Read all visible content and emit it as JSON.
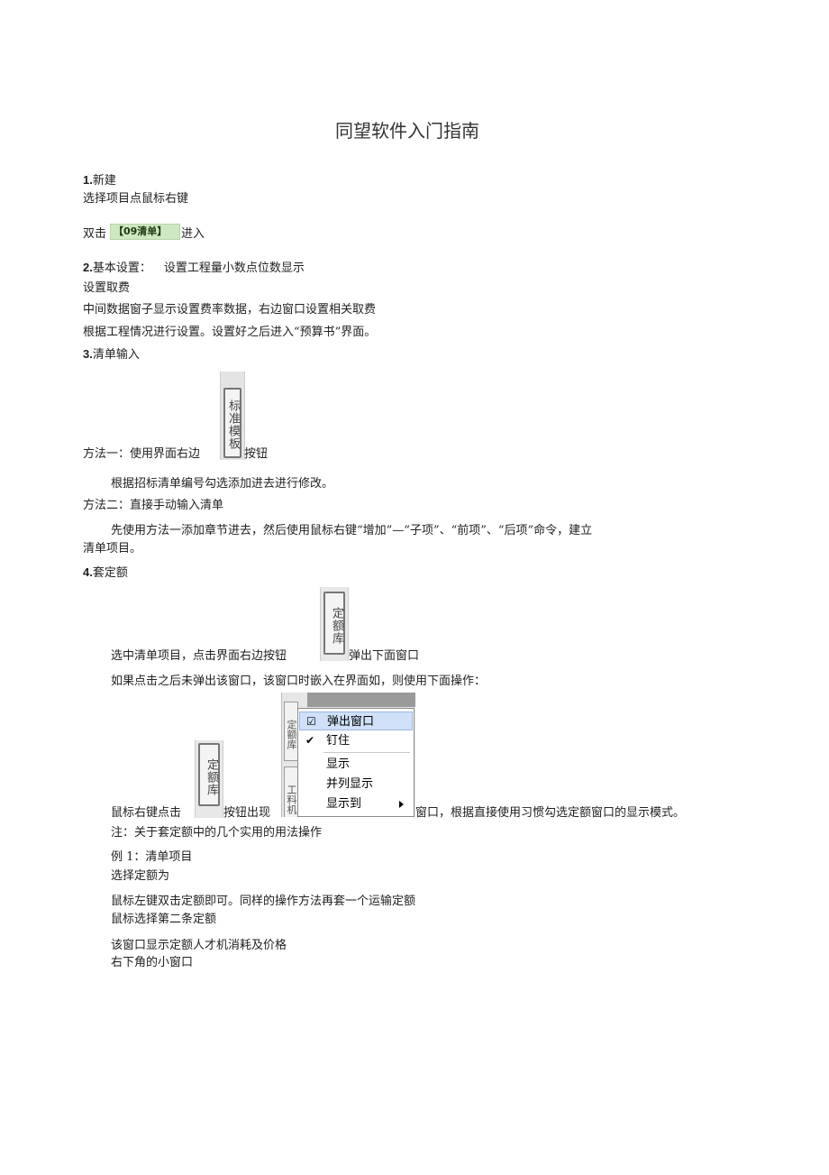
{
  "title": "同望软件入门指南",
  "sec1": {
    "num": "1.",
    "heading": "新建",
    "line1": "选择项目点鼠标右键",
    "line2_pre": "双击",
    "qd_button": "【09清单】",
    "line2_post": "进入"
  },
  "sec2": {
    "num": "2.",
    "heading": "基本设置：",
    "heading_tail": "设置工程量小数点位数显示",
    "line1": "设置取费",
    "line2": "中间数据窗子显示设置费率数据，右边窗口设置相关取费",
    "line3": "根据工程情况进行设置。设置好之后进入“预算书”界面。"
  },
  "sec3": {
    "num": "3.",
    "heading": "清单输入",
    "method1_pre": "方法一：使用界面右边",
    "template_button": "标准模板",
    "method1_post": "按钮",
    "method1_desc": "根据招标清单编号勾选添加进去进行修改。",
    "method2": "方法二：直接手动输入清单",
    "method2_desc_line1": "先使用方法一添加章节进去，然后使用鼠标右键“增加”—“子项”、“前项”、“后项”命令，建立",
    "method2_desc_line2": "清单项目。"
  },
  "sec4": {
    "num": "4.",
    "heading": "套定额",
    "line1_pre": "选中清单项目，点击界面右边按钮",
    "quota_button": "定额库",
    "line1_post": "弹出下面窗口",
    "line2": "如果点击之后未弹出该窗口，该窗口时嵌入在界面如，则使用下面操作：",
    "line3_pre": "鼠标右键点击",
    "line3_mid": "按钮出现",
    "line3_post": "窗口，根据直接使用习惯勾选定额窗口的显示模式。",
    "side_tab_top": "定额库",
    "side_tab_bottom": "工料机",
    "context_menu": {
      "items": [
        "弹出窗口",
        "钉住",
        "显示",
        "并列显示",
        "显示到"
      ]
    },
    "note": "注：关于套定额中的几个实用的用法操作",
    "ex1": "例 1：清单项目",
    "ex1_line2": "选择定额为",
    "ex1_line3": "鼠标左键双击定额即可。同样的操作方法再套一个运输定额",
    "ex1_line4": "鼠标选择第二条定额",
    "ex1_line5": "该窗口显示定额人才机消耗及价格",
    "ex1_line6": "右下角的小窗口"
  }
}
